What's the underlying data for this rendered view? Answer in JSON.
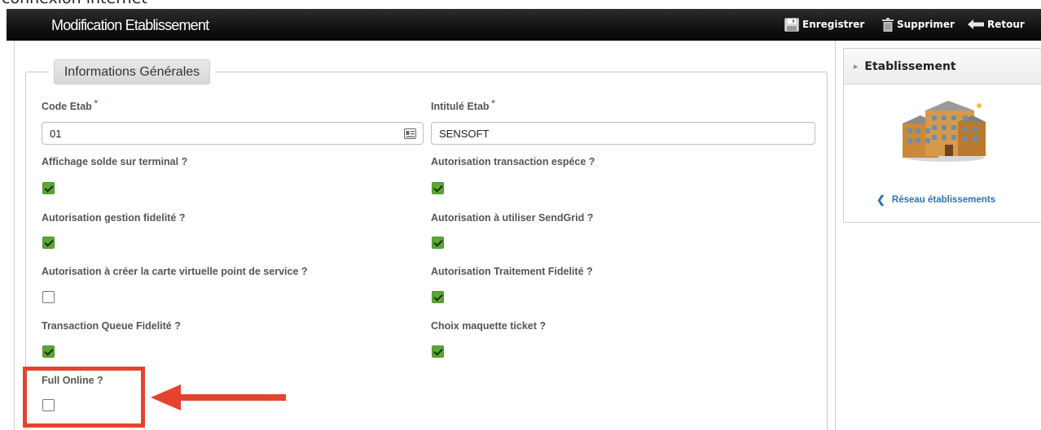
{
  "page_top_text": "connexion internet",
  "header": {
    "title": "Modification Etablissement",
    "save_label": "Enregistrer",
    "delete_label": "Supprimer",
    "back_label": "Retour"
  },
  "fieldset": {
    "legend": "Informations Générales"
  },
  "fields": {
    "code_etab": {
      "label": "Code Etab",
      "required_mark": "*",
      "value": "01"
    },
    "intitule_etab": {
      "label": "Intitulé Etab",
      "required_mark": "*",
      "value": "SENSOFT"
    }
  },
  "options": [
    {
      "label": "Affichage solde sur terminal ?",
      "checked": true
    },
    {
      "label": "Autorisation transaction espéce ?",
      "checked": true
    },
    {
      "label": "Autorisation gestion fidelité ?",
      "checked": true
    },
    {
      "label": "Autorisation à utiliser SendGrid ?",
      "checked": true
    },
    {
      "label": "Autorisation à créer la carte virtuelle point de service ?",
      "checked": false
    },
    {
      "label": "Autorisation Traitement Fidelité ?",
      "checked": true
    },
    {
      "label": "Transaction Queue Fidelité ?",
      "checked": true
    },
    {
      "label": "Choix maquette ticket ?",
      "checked": true
    },
    {
      "label": "Full Online ?",
      "checked": false
    }
  ],
  "sidebar": {
    "title": "Etablissement",
    "link_label": "Réseau établissements"
  },
  "colors": {
    "checkbox_checked": "#5aa834",
    "highlight": "#e5432d",
    "link": "#2e72b5",
    "required": "#c0272d"
  }
}
